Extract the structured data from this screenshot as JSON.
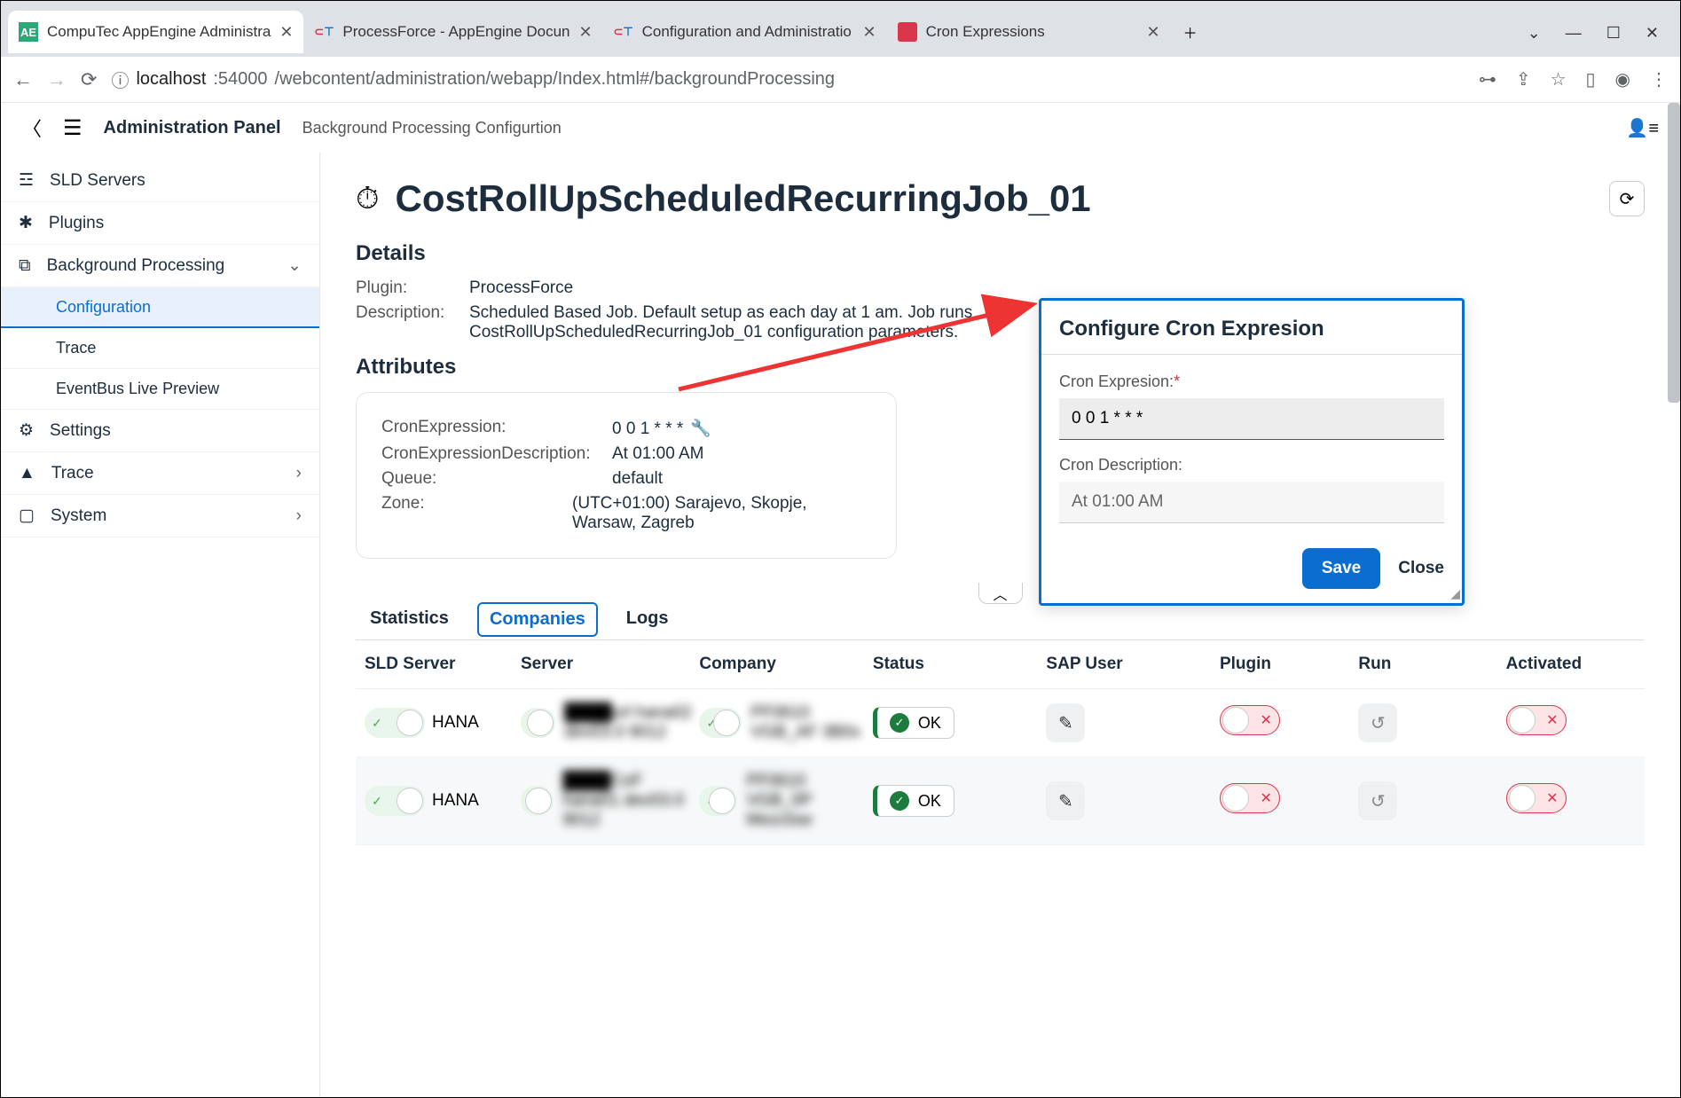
{
  "browser": {
    "tabs": [
      {
        "favicon": "AE",
        "fbg": "#2aa876",
        "fcolor": "#fff",
        "title": "CompuTec AppEngine Administra",
        "active": true
      },
      {
        "favicon": "CT",
        "fbg": "#fff",
        "fcolor": "#d9364c",
        "title": "ProcessForce - AppEngine Docun",
        "active": false
      },
      {
        "favicon": "CT",
        "fbg": "#fff",
        "fcolor": "#d9364c",
        "title": "Configuration and Administratio",
        "active": false
      },
      {
        "favicon": "◼",
        "fbg": "#d9364c",
        "fcolor": "#fff",
        "title": "Cron Expressions",
        "active": false
      }
    ],
    "url_host": "localhost",
    "url_port": ":54000",
    "url_path": "/webcontent/administration/webapp/Index.html#/backgroundProcessing"
  },
  "header": {
    "title": "Administration Panel",
    "subtitle": "Background Processing Configurtion"
  },
  "sidebar": {
    "items": [
      {
        "icon": "☲",
        "label": "SLD Servers"
      },
      {
        "icon": "✱",
        "label": "Plugins"
      },
      {
        "icon": "⧉",
        "label": "Background Processing",
        "expand": true,
        "subs": [
          "Configuration",
          "Trace",
          "EventBus Live Preview"
        ],
        "active_sub": 0
      },
      {
        "icon": "⚙",
        "label": "Settings"
      },
      {
        "icon": "▲",
        "label": "Trace",
        "arrow": true
      },
      {
        "icon": "▭",
        "label": "System",
        "arrow": true
      }
    ]
  },
  "page": {
    "title": "CostRollUpScheduledRecurringJob_01",
    "details_h": "Details",
    "plugin_k": "Plugin:",
    "plugin_v": "ProcessForce",
    "desc_k": "Description:",
    "desc_v": "Scheduled Based Job. Default setup as each day at 1 am. Job runs CostRollUpScheduledRecurringJob_01 configuration parameters.",
    "attr_h": "Attributes",
    "attr": {
      "cron_k": "CronExpression:",
      "cron_v": "0 0 1 * * *",
      "crondesc_k": "CronExpressionDescription:",
      "crondesc_v": "At 01:00 AM",
      "queue_k": "Queue:",
      "queue_v": "default",
      "zone_k": "Zone:",
      "zone_v": "(UTC+01:00) Sarajevo, Skopje, Warsaw, Zagreb"
    }
  },
  "tabs": [
    "Statistics",
    "Companies",
    "Logs"
  ],
  "active_tab": 1,
  "table": {
    "headers": [
      "SLD Server",
      "Server",
      "Company",
      "Status",
      "SAP User",
      "Plugin",
      "Run",
      "Activated"
    ],
    "rows": [
      {
        "sld": "HANA",
        "server": "████url hana02 dev03.0 9012",
        "company": "PF0610 VGB_AF 3B0x",
        "status": "OK"
      },
      {
        "sld": "HANA",
        "server": "████CoF hana01 dev03.0 9012",
        "company": "PF0610 VGB_0P Mezclow",
        "status": "OK"
      }
    ]
  },
  "dialog": {
    "title": "Configure Cron Expresion",
    "l1": "Cron Expresion:",
    "v1": "0 0 1 * * *",
    "l2": "Cron Description:",
    "v2": "At 01:00 AM",
    "save": "Save",
    "close": "Close"
  }
}
